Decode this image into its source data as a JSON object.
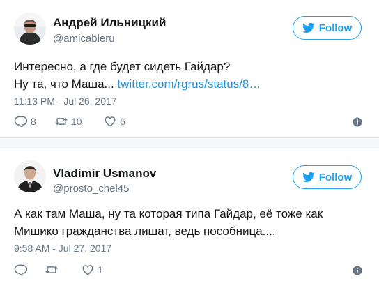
{
  "tweets": [
    {
      "author_name": "Андрей Ильницкий",
      "author_handle": "@amicableru",
      "follow_label": "Follow",
      "text_line1": "Интересно, а где будет сидеть Гайдар?",
      "text_line2_prefix": "Ну та, что Маша... ",
      "link_text": "twitter.com/rgrus/status/8…",
      "timestamp": "11:13 PM - Jul 26, 2017",
      "replies": "8",
      "retweets": "10",
      "likes": "6"
    },
    {
      "author_name": "Vladimir Usmanov",
      "author_handle": "@prosto_chel45",
      "follow_label": "Follow",
      "text_line1": "А как там Маша, ну та которая типа Гайдар, её тоже как",
      "text_line2": "Мишико гражданства лишат, ведь пособница....",
      "timestamp": "9:58 AM - Jul 27, 2017",
      "replies": "",
      "retweets": "",
      "likes": "1"
    }
  ],
  "colors": {
    "twitter_blue": "#1da1f2",
    "link_blue": "#1b95e0",
    "secondary_text": "#657786"
  },
  "icons": [
    "twitter-bird-icon",
    "reply-icon",
    "retweet-icon",
    "like-icon",
    "info-icon"
  ]
}
